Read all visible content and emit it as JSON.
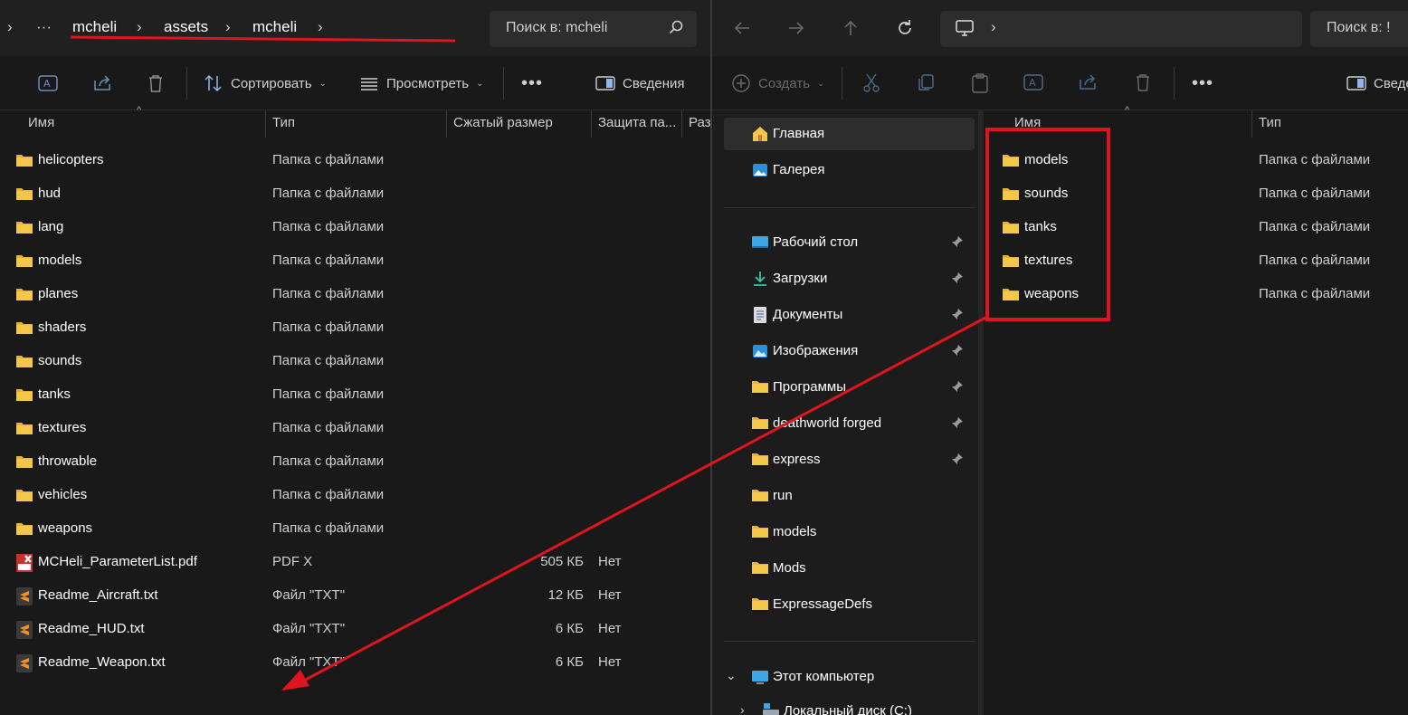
{
  "left": {
    "breadcrumb": [
      "mcheli",
      "assets",
      "mcheli"
    ],
    "search_placeholder": "Поиск в: mcheli",
    "toolbar": {
      "sort": "Сортировать",
      "view": "Просмотреть",
      "details": "Сведения"
    },
    "columns": {
      "name": "Имя",
      "type": "Тип",
      "size": "Сжатый размер",
      "protect": "Защита па...",
      "ratio": "Раз"
    },
    "rows": [
      {
        "name": "helicopters",
        "type": "Папка с файлами",
        "size": "",
        "prot": "",
        "icon": "folder-icon"
      },
      {
        "name": "hud",
        "type": "Папка с файлами",
        "size": "",
        "prot": "",
        "icon": "folder-icon"
      },
      {
        "name": "lang",
        "type": "Папка с файлами",
        "size": "",
        "prot": "",
        "icon": "folder-icon"
      },
      {
        "name": "models",
        "type": "Папка с файлами",
        "size": "",
        "prot": "",
        "icon": "folder-icon"
      },
      {
        "name": "planes",
        "type": "Папка с файлами",
        "size": "",
        "prot": "",
        "icon": "folder-icon"
      },
      {
        "name": "shaders",
        "type": "Папка с файлами",
        "size": "",
        "prot": "",
        "icon": "folder-icon"
      },
      {
        "name": "sounds",
        "type": "Папка с файлами",
        "size": "",
        "prot": "",
        "icon": "folder-icon"
      },
      {
        "name": "tanks",
        "type": "Папка с файлами",
        "size": "",
        "prot": "",
        "icon": "folder-icon"
      },
      {
        "name": "textures",
        "type": "Папка с файлами",
        "size": "",
        "prot": "",
        "icon": "folder-icon"
      },
      {
        "name": "throwable",
        "type": "Папка с файлами",
        "size": "",
        "prot": "",
        "icon": "folder-icon"
      },
      {
        "name": "vehicles",
        "type": "Папка с файлами",
        "size": "",
        "prot": "",
        "icon": "folder-icon"
      },
      {
        "name": "weapons",
        "type": "Папка с файлами",
        "size": "",
        "prot": "",
        "icon": "folder-icon"
      },
      {
        "name": "MCHeli_ParameterList.pdf",
        "type": "PDF X",
        "size": "505 КБ",
        "prot": "Нет",
        "icon": "pdf-icon"
      },
      {
        "name": "Readme_Aircraft.txt",
        "type": "Файл \"TXT\"",
        "size": "12 КБ",
        "prot": "Нет",
        "icon": "sublime-text-icon"
      },
      {
        "name": "Readme_HUD.txt",
        "type": "Файл \"TXT\"",
        "size": "6 КБ",
        "prot": "Нет",
        "icon": "sublime-text-icon"
      },
      {
        "name": "Readme_Weapon.txt",
        "type": "Файл \"TXT\"",
        "size": "6 КБ",
        "prot": "Нет",
        "icon": "sublime-text-icon"
      }
    ]
  },
  "right": {
    "search_placeholder": "Поиск в: !",
    "toolbar": {
      "create": "Создать",
      "details": "Сведе"
    },
    "columns": {
      "name": "Имя",
      "type": "Тип"
    },
    "nav": [
      {
        "label": "Главная",
        "icon": "home-icon",
        "pinned": false
      },
      {
        "label": "Галерея",
        "icon": "gallery-icon",
        "pinned": false
      },
      {
        "label": "Рабочий стол",
        "icon": "desktop-icon",
        "pinned": true
      },
      {
        "label": "Загрузки",
        "icon": "download-icon",
        "pinned": true
      },
      {
        "label": "Документы",
        "icon": "documents-icon",
        "pinned": true
      },
      {
        "label": "Изображения",
        "icon": "pictures-icon",
        "pinned": true
      },
      {
        "label": "Программы",
        "icon": "folder-icon",
        "pinned": true
      },
      {
        "label": "deathworld forged",
        "icon": "folder-icon",
        "pinned": true
      },
      {
        "label": "express",
        "icon": "folder-icon",
        "pinned": true
      },
      {
        "label": "run",
        "icon": "folder-icon",
        "pinned": false
      },
      {
        "label": "models",
        "icon": "folder-icon",
        "pinned": false
      },
      {
        "label": "Mods",
        "icon": "folder-icon",
        "pinned": false
      },
      {
        "label": "ExpressageDefs",
        "icon": "folder-icon",
        "pinned": false
      },
      {
        "label": "Этот компьютер",
        "icon": "computer-icon",
        "pinned": false
      },
      {
        "label": "Локальный диск (C:)",
        "icon": "drive-icon",
        "pinned": false
      }
    ],
    "rows": [
      {
        "name": "models",
        "type": "Папка с файлами"
      },
      {
        "name": "sounds",
        "type": "Папка с файлами"
      },
      {
        "name": "tanks",
        "type": "Папка с файлами"
      },
      {
        "name": "textures",
        "type": "Папка с файлами"
      },
      {
        "name": "weapons",
        "type": "Папка с файлами"
      }
    ]
  },
  "colors": {
    "annotation": "#e0141e",
    "folder": "#f4c74a"
  }
}
